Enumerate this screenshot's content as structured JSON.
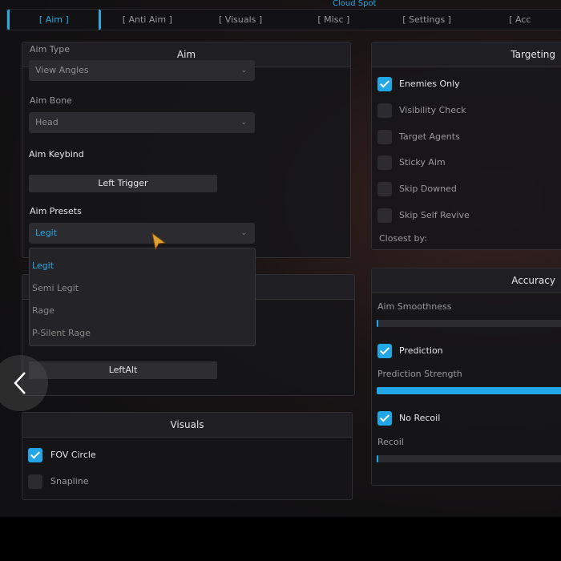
{
  "window_title": "Cloud Spot",
  "tabs": [
    "[ Aim ]",
    "[ Anti Aim ]",
    "[ Visuals ]",
    "[ Misc ]",
    "[ Settings ]",
    "[ Acc"
  ],
  "active_tab": 0,
  "aim_panel": {
    "title": "Aim",
    "aim_type_label": "Aim Type",
    "aim_type_value": "View Angles",
    "aim_bone_label": "Aim Bone",
    "aim_bone_value": "Head",
    "aim_keybind_label": "Aim Keybind",
    "aim_keybind_value": "Left Trigger",
    "aim_presets_label": "Aim Presets",
    "aim_presets_value": "Legit"
  },
  "presets_menu": {
    "options": [
      "Legit",
      "Semi Legit",
      "Rage",
      "P-Silent Rage"
    ],
    "selected": "Legit"
  },
  "second_panel": {
    "keybind_value": "LeftAlt"
  },
  "visuals_panel": {
    "title": "Visuals",
    "items": [
      {
        "label": "FOV Circle",
        "checked": true
      },
      {
        "label": "Snapline",
        "checked": false
      }
    ]
  },
  "targeting_panel": {
    "title": "Targeting",
    "items": [
      {
        "label": "Enemies Only",
        "checked": true
      },
      {
        "label": "Visibility Check",
        "checked": false
      },
      {
        "label": "Target Agents",
        "checked": false
      },
      {
        "label": "Sticky Aim",
        "checked": false
      },
      {
        "label": "Skip Downed",
        "checked": false
      },
      {
        "label": "Skip Self Revive",
        "checked": false
      }
    ],
    "closest_by_label": "Closest by:"
  },
  "accuracy_panel": {
    "title": "Accuracy",
    "aim_smoothness_label": "Aim Smoothness",
    "aim_smoothness": 0.01,
    "prediction_label": "Prediction",
    "prediction_checked": true,
    "prediction_strength_label": "Prediction Strength",
    "prediction_strength": 1.0,
    "no_recoil_label": "No Recoil",
    "no_recoil_checked": true,
    "recoil_label": "Recoil",
    "recoil": 0.01
  },
  "accent_color": "#22a7e6",
  "nav": {
    "back_icon": "chevron-left-icon"
  }
}
